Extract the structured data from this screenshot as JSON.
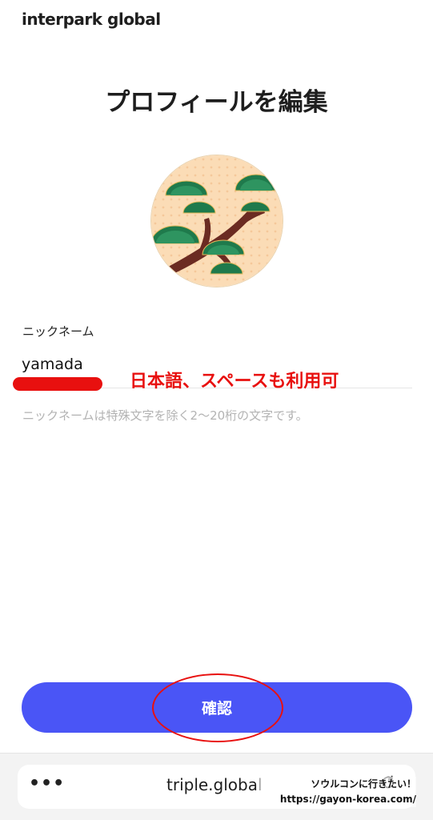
{
  "header": {
    "brand": "interpark global"
  },
  "main": {
    "title": "プロフィールを編集",
    "avatar_icon": "pine-tree-avatar-icon",
    "nickname": {
      "label": "ニックネーム",
      "value": "yamada",
      "helper": "ニックネームは特殊文字を除く2〜20桁の文字です。"
    },
    "annotation_text": "日本語、スペースも利用可",
    "confirm_label": "確認"
  },
  "browser_bar": {
    "more_icon": "more-dots-icon",
    "url": "triple.global",
    "reload_icon": "reload-icon"
  },
  "watermark": {
    "line1": "ソウルコンに行きたい！",
    "line2": "https://gayon-korea.com/"
  },
  "colors": {
    "accent": "#4a55f6",
    "annotation": "#e8100f",
    "helper_text": "#b3b3b3"
  }
}
